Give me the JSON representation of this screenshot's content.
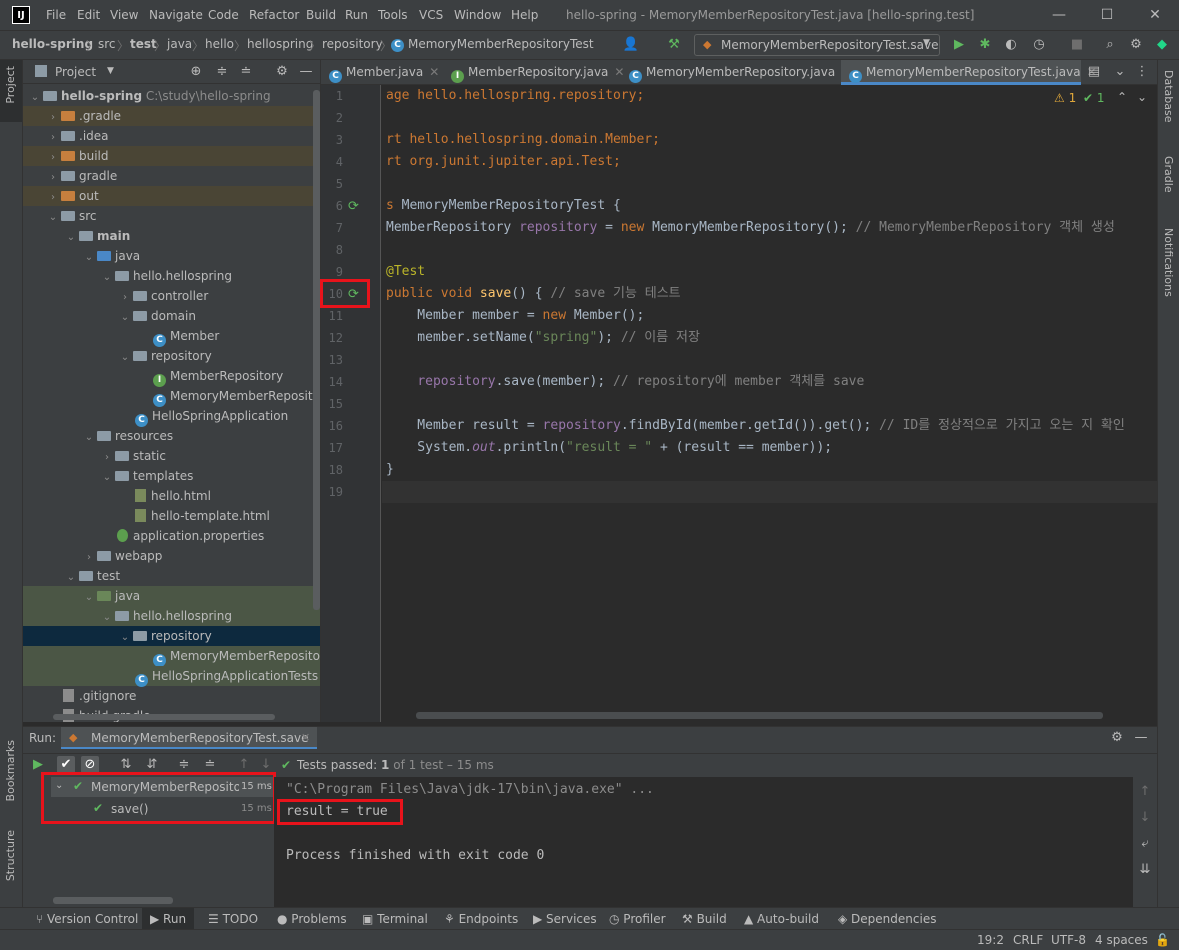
{
  "menu": [
    "File",
    "Edit",
    "View",
    "Navigate",
    "Code",
    "Refactor",
    "Build",
    "Run",
    "Tools",
    "VCS",
    "Window",
    "Help"
  ],
  "window_title": "hello-spring - MemoryMemberRepositoryTest.java [hello-spring.test]",
  "breadcrumbs": [
    "hello-spring",
    "src",
    "test",
    "java",
    "hello",
    "hellospring",
    "repository",
    "MemoryMemberRepositoryTest"
  ],
  "run_config": "MemoryMemberRepositoryTest.save",
  "project_panel": {
    "title": "Project",
    "tree": [
      {
        "label": "hello-spring",
        "path": "C:\\study\\hello-spring"
      },
      {
        "label": ".gradle"
      },
      {
        "label": ".idea"
      },
      {
        "label": "build"
      },
      {
        "label": "gradle"
      },
      {
        "label": "out"
      },
      {
        "label": "src"
      },
      {
        "label": "main"
      },
      {
        "label": "java"
      },
      {
        "label": "hello.hellospring"
      },
      {
        "label": "controller"
      },
      {
        "label": "domain"
      },
      {
        "label": "Member"
      },
      {
        "label": "repository"
      },
      {
        "label": "MemberRepository"
      },
      {
        "label": "MemoryMemberRepository"
      },
      {
        "label": "HelloSpringApplication"
      },
      {
        "label": "resources"
      },
      {
        "label": "static"
      },
      {
        "label": "templates"
      },
      {
        "label": "hello.html"
      },
      {
        "label": "hello-template.html"
      },
      {
        "label": "application.properties"
      },
      {
        "label": "webapp"
      },
      {
        "label": "test"
      },
      {
        "label": "java"
      },
      {
        "label": "hello.hellospring"
      },
      {
        "label": "repository"
      },
      {
        "label": "MemoryMemberRepository"
      },
      {
        "label": "HelloSpringApplicationTests"
      },
      {
        "label": ".gitignore"
      },
      {
        "label": "build.gradle"
      }
    ]
  },
  "tabs": [
    "Member.java",
    "MemberRepository.java",
    "MemoryMemberRepository.java",
    "MemoryMemberRepositoryTest.java"
  ],
  "inspections": {
    "warnings": "1",
    "ok": "1"
  },
  "line_numbers": [
    "1",
    "2",
    "3",
    "4",
    "5",
    "6",
    "7",
    "8",
    "9",
    "10",
    "11",
    "12",
    "13",
    "14",
    "15",
    "16",
    "17",
    "18",
    "19"
  ],
  "code": {
    "l1": "age hello.hellospring.repository;",
    "l3": "rt hello.hellospring.domain.Member;",
    "l4": "rt org.junit.jupiter.api.Test;",
    "l6a": "s ",
    "l6b": "MemoryMemberRepositoryTest {",
    "l7a": "MemberRepository ",
    "l7b": "repository",
    "l7c": " = ",
    "l7d": "new",
    "l7e": " MemoryMemberRepository(); ",
    "l7f": "// MemoryMemberRepository 객체 생성",
    "l9": "@Test",
    "l10a": "public void ",
    "l10b": "save",
    "l10c": "() { ",
    "l10d": "// save 기능 테스트",
    "l11a": "    Member member = ",
    "l11b": "new",
    "l11c": " Member();",
    "l12a": "    member.setName(",
    "l12b": "\"spring\"",
    "l12c": "); ",
    "l12d": "// 이름 저장",
    "l14a": "    ",
    "l14b": "repository",
    "l14c": ".save(member); ",
    "l14d": "// repository에 member 객체를 save",
    "l16a": "    Member result = ",
    "l16b": "repository",
    "l16c": ".findById(member.getId()).get(); ",
    "l16d": "// ID를 정상적으로 가지고 오는 지 확인",
    "l17a": "    System.",
    "l17b": "out",
    "l17c": ".println(",
    "l17d": "\"result = \"",
    "l17e": " + (result == member));",
    "l18": "}"
  },
  "run": {
    "label": "Run:",
    "tab": "MemoryMemberRepositoryTest.save",
    "status": "Tests passed:",
    "status_count": "1",
    "status_rest": "of 1 test – 15 ms",
    "tree": [
      {
        "label": "MemoryMemberRepository",
        "time": "15 ms"
      },
      {
        "label": "save()",
        "time": "15 ms"
      }
    ],
    "console": [
      "\"C:\\Program Files\\Java\\jdk-17\\bin\\java.exe\" ...",
      "result = true",
      "",
      "Process finished with exit code 0"
    ]
  },
  "left_strip": [
    "Project",
    "Bookmarks",
    "Structure"
  ],
  "right_strip": [
    "Database",
    "Gradle",
    "Notifications"
  ],
  "bottom_tools": [
    "Version Control",
    "Run",
    "TODO",
    "Problems",
    "Terminal",
    "Endpoints",
    "Services",
    "Profiler",
    "Build",
    "Auto-build",
    "Dependencies"
  ],
  "status_bar": {
    "position": "19:2",
    "line_sep": "CRLF",
    "encoding": "UTF-8",
    "indent": "4 spaces"
  },
  "colors": {
    "accent": "#4a88c7",
    "highlight_box": "#e8131b",
    "pass_green": "#5fb85f"
  }
}
